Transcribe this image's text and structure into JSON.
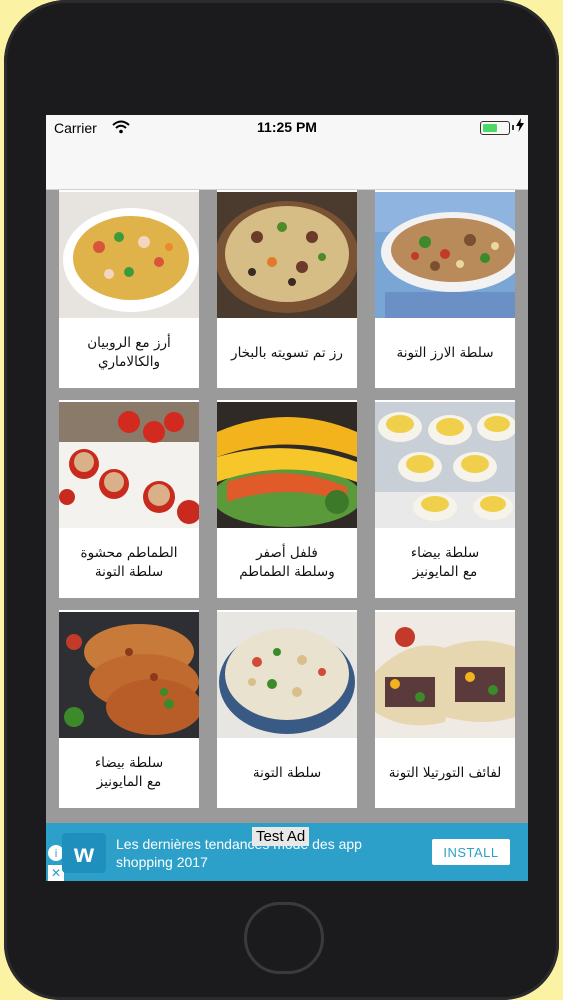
{
  "status_bar": {
    "carrier": "Carrier",
    "time": "11:25 PM",
    "battery_level": 0.6
  },
  "recipes": [
    {
      "label": "سلطة الارز التونة",
      "image": "tuna-rice-salad"
    },
    {
      "label": "رز تم تسويته بالبخار",
      "image": "steamed-rice"
    },
    {
      "label": "أرز مع الروبيان\nوالكالاماري",
      "image": "rice-shrimp-calamari"
    },
    {
      "label": "سلطة بيضاء\nمع المايونيز",
      "image": "egg-mayo-salad"
    },
    {
      "label": "فلفل أصفر\nوسلطة الطماطم",
      "image": "pepper-tomato-salad"
    },
    {
      "label": "الطماطم محشوة\nسلطة التونة",
      "image": "stuffed-tomatoes"
    },
    {
      "label": "لفائف التورتيلا التونة",
      "image": "tortilla-wraps"
    },
    {
      "label": "سلطة التونة",
      "image": "tuna-salad"
    },
    {
      "label": "سلطة بيضاء\nمع المايونيز",
      "image": "flatbread"
    }
  ],
  "ad": {
    "label": "Test Ad",
    "text": "Les dernières tendances mode des app shopping 2017",
    "install": "INSTALL",
    "logo": "w",
    "info_icon": "i",
    "close_icon": "✕"
  },
  "colors": {
    "ad_background": "#2ca0c8",
    "grid_background": "#9a9a9a"
  }
}
